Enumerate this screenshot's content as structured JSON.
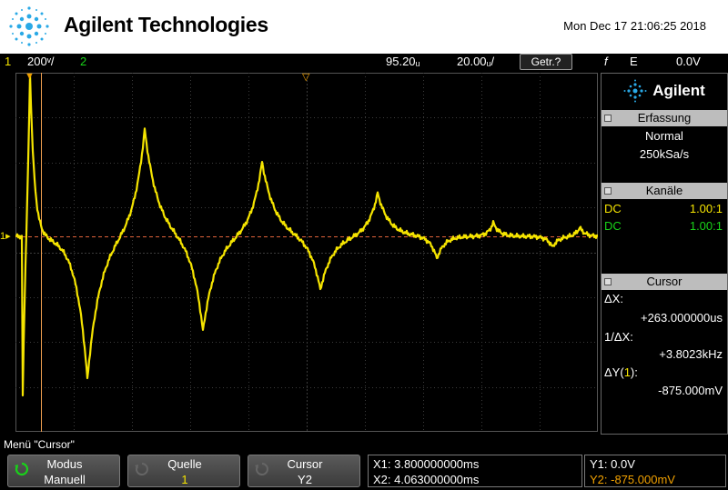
{
  "header": {
    "brand": "Agilent Technologies",
    "datetime": "Mon Dec 17 21:06:25 2018"
  },
  "status": {
    "ch1_number": "1",
    "ch1_scale": "200ᵛ/",
    "ch2_number": "2",
    "horizontal_position": "95.20ᵤ",
    "time_per_div": "20.00ᵤ/",
    "trigger_button": "Getr.?",
    "trigger_edge": "f",
    "trigger_source": "E",
    "trigger_level": "0.0V"
  },
  "ground_marker": "1",
  "panel": {
    "logo_name": "Agilent",
    "acquisition": {
      "title": "Erfassung",
      "mode": "Normal",
      "rate": "250kSa/s"
    },
    "channels": {
      "title": "Kanäle",
      "rows": [
        {
          "coupling": "DC",
          "probe": "1.00:1",
          "color": "#f5e400"
        },
        {
          "coupling": "DC",
          "probe": "1.00:1",
          "color": "#19d219"
        }
      ]
    },
    "cursor": {
      "title": "Cursor",
      "dx_label": "ΔX:",
      "dx_value": "+263.000000us",
      "inv_dx_label": "1/ΔX:",
      "inv_dx_value": "+3.8023kHz",
      "dy_label_prefix": "ΔY(",
      "dy_label_channel": "1",
      "dy_label_suffix": "):",
      "dy_value": "-875.000mV"
    }
  },
  "menu_title": "Menü \"Cursor\"",
  "softkeys": [
    {
      "label": "Modus",
      "value": "Manuell",
      "value_color": "#ffffff"
    },
    {
      "label": "Quelle",
      "value": "1",
      "value_color": "#f5e400"
    },
    {
      "label": "Cursor",
      "value": "Y2",
      "value_color": "#ffffff"
    }
  ],
  "readouts": {
    "x1": "X1: 3.800000000ms",
    "x2": "X2: 4.063000000ms",
    "y1": "Y1: 0.0V",
    "y2": "Y2: -875.000mV"
  },
  "colors": {
    "ch1": "#f5e400",
    "ch2": "#19d219",
    "cursor_x": "#f0a050",
    "cursor_y": "#e0623a",
    "accent_orange": "#f0a000"
  }
}
